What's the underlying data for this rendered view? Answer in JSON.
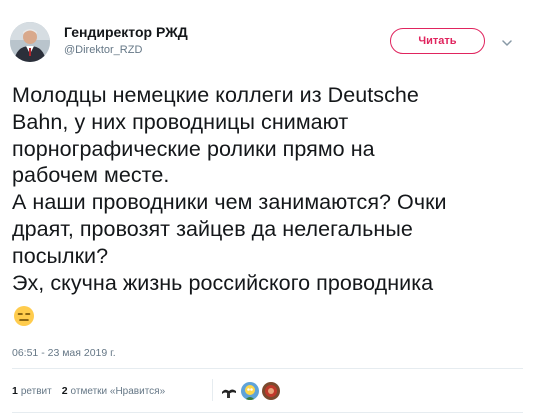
{
  "author": {
    "display_name": "Гендиректор РЖД",
    "handle": "@Direktor_RZD",
    "avatar_icon": "avatar-portrait"
  },
  "follow_button": {
    "label": "Читать",
    "color": "#e0245e"
  },
  "menu_icon": "chevron-down-icon",
  "tweet": {
    "lines": [
      "Молодцы немецкие коллеги из Deutsche",
      "Bahn, у них проводницы снимают",
      "порнографические ролики прямо на",
      "рабочем месте.",
      "А наши проводники чем занимаются? Очки",
      "драят, провозят зайцев да нелегальные",
      "посылки?",
      "Эх, скучна жизнь российского проводника"
    ],
    "emoji": "expressionless-face"
  },
  "timestamp": "06:51 - 23 мая 2019 г.",
  "stats": {
    "retweets_count": "1",
    "retweets_label": "ретвит",
    "likes_count": "2",
    "likes_label": "отметки «Нравится»"
  },
  "likers": [
    "liker-avatar-1",
    "liker-avatar-2",
    "liker-avatar-3"
  ],
  "colors": {
    "text": "#14171a",
    "secondary": "#657786",
    "divider": "#e6ecf0"
  }
}
